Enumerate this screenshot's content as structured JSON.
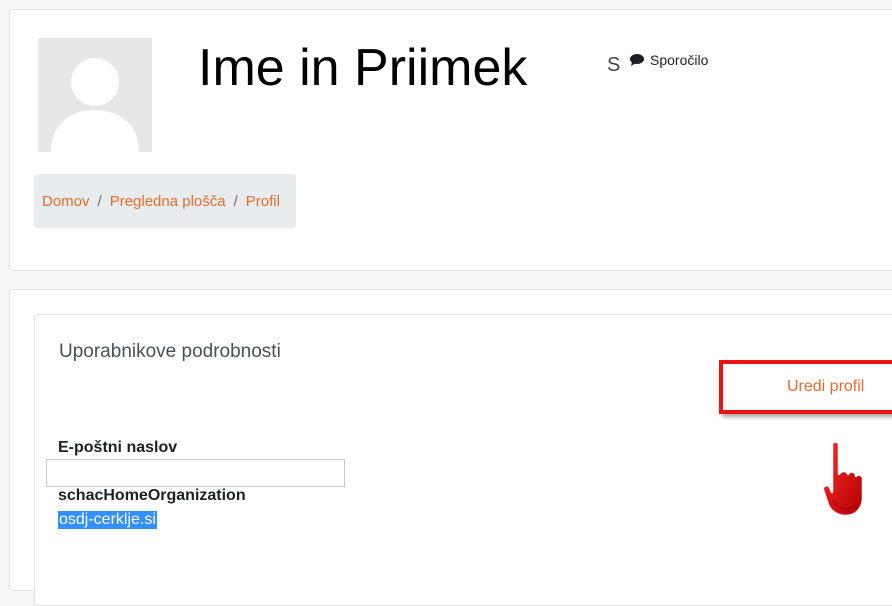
{
  "profile": {
    "full_name": "Ime in Priimek",
    "name_trail": "S",
    "message_label": "Sporočilo",
    "message_icon": "comment-icon"
  },
  "breadcrumb": {
    "items": [
      "Domov",
      "Pregledna plošča",
      "Profil"
    ],
    "separator": "/"
  },
  "details": {
    "section_title": "Uporabnikove podrobnosti",
    "edit_label": "Uredi profil",
    "fields": [
      {
        "label": "E-poštni naslov",
        "value": ""
      },
      {
        "label": "schacHomeOrganization",
        "value": "osdj-cerklje.si"
      }
    ]
  },
  "colors": {
    "link": "#e06d2a",
    "highlight": "#ee1111",
    "selection": "#3390ff"
  }
}
